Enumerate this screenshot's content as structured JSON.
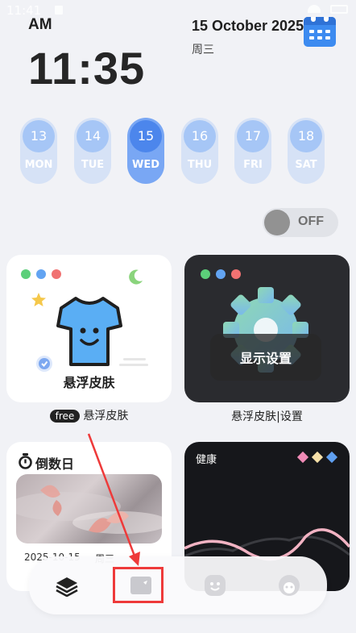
{
  "status_bar": {
    "time": "11:41"
  },
  "header": {
    "ampm": "AM",
    "time": "11:35",
    "date": "15 October 2025",
    "weekday": "周三",
    "calendar_icon": "calendar-icon"
  },
  "days": [
    {
      "num": "13",
      "label": "MON",
      "active": false
    },
    {
      "num": "14",
      "label": "TUE",
      "active": false
    },
    {
      "num": "15",
      "label": "WED",
      "active": true
    },
    {
      "num": "16",
      "label": "THU",
      "active": false
    },
    {
      "num": "17",
      "label": "FRI",
      "active": false
    },
    {
      "num": "18",
      "label": "SAT",
      "active": false
    }
  ],
  "toggle": {
    "label": "OFF",
    "state": "off"
  },
  "cards": {
    "skin": {
      "title": "悬浮皮肤",
      "caption_badge": "free",
      "caption": "悬浮皮肤"
    },
    "display": {
      "overlay_text": "显示设置",
      "caption": "悬浮皮肤|设置"
    },
    "countdown": {
      "title": "倒数日",
      "date": "2025-10-15",
      "weekday": "周三"
    },
    "health": {
      "title": "健康"
    }
  },
  "navbar": {
    "items": [
      "layers-icon",
      "card-icon",
      "smile-icon",
      "face-icon"
    ],
    "selected": "card-icon"
  },
  "colors": {
    "accent_blue": "#4c86ec",
    "annotation_red": "#ee3a3a",
    "dot_green": "#5ccf7a",
    "dot_blue": "#62a4f2",
    "dot_red": "#f07272"
  }
}
